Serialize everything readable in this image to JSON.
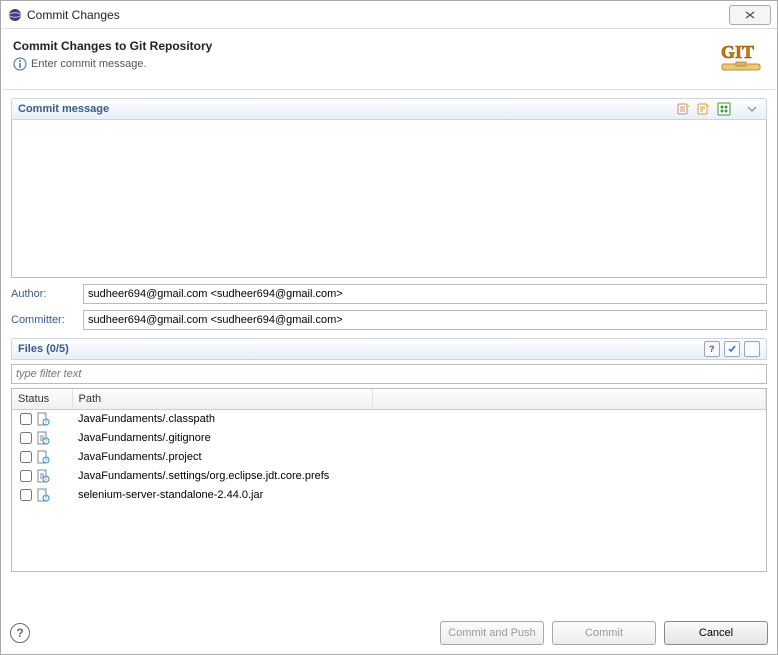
{
  "window": {
    "title": "Commit Changes"
  },
  "header": {
    "title": "Commit Changes to Git Repository",
    "subtitle": "Enter commit message."
  },
  "commitMessage": {
    "section_label": "Commit message",
    "value": ""
  },
  "author": {
    "label": "Author:",
    "value": "sudheer694@gmail.com <sudheer694@gmail.com>"
  },
  "committer": {
    "label": "Committer:",
    "value": "sudheer694@gmail.com <sudheer694@gmail.com>"
  },
  "files": {
    "section_label": "Files (0/5)",
    "filter_placeholder": "type filter text",
    "columns": {
      "status": "Status",
      "path": "Path"
    },
    "items": [
      {
        "path": "JavaFundaments/.classpath"
      },
      {
        "path": "JavaFundaments/.gitignore"
      },
      {
        "path": "JavaFundaments/.project"
      },
      {
        "path": "JavaFundaments/.settings/org.eclipse.jdt.core.prefs"
      },
      {
        "path": "selenium-server-standalone-2.44.0.jar"
      }
    ]
  },
  "buttons": {
    "commit_and_push": "Commit and Push",
    "commit": "Commit",
    "cancel": "Cancel"
  }
}
